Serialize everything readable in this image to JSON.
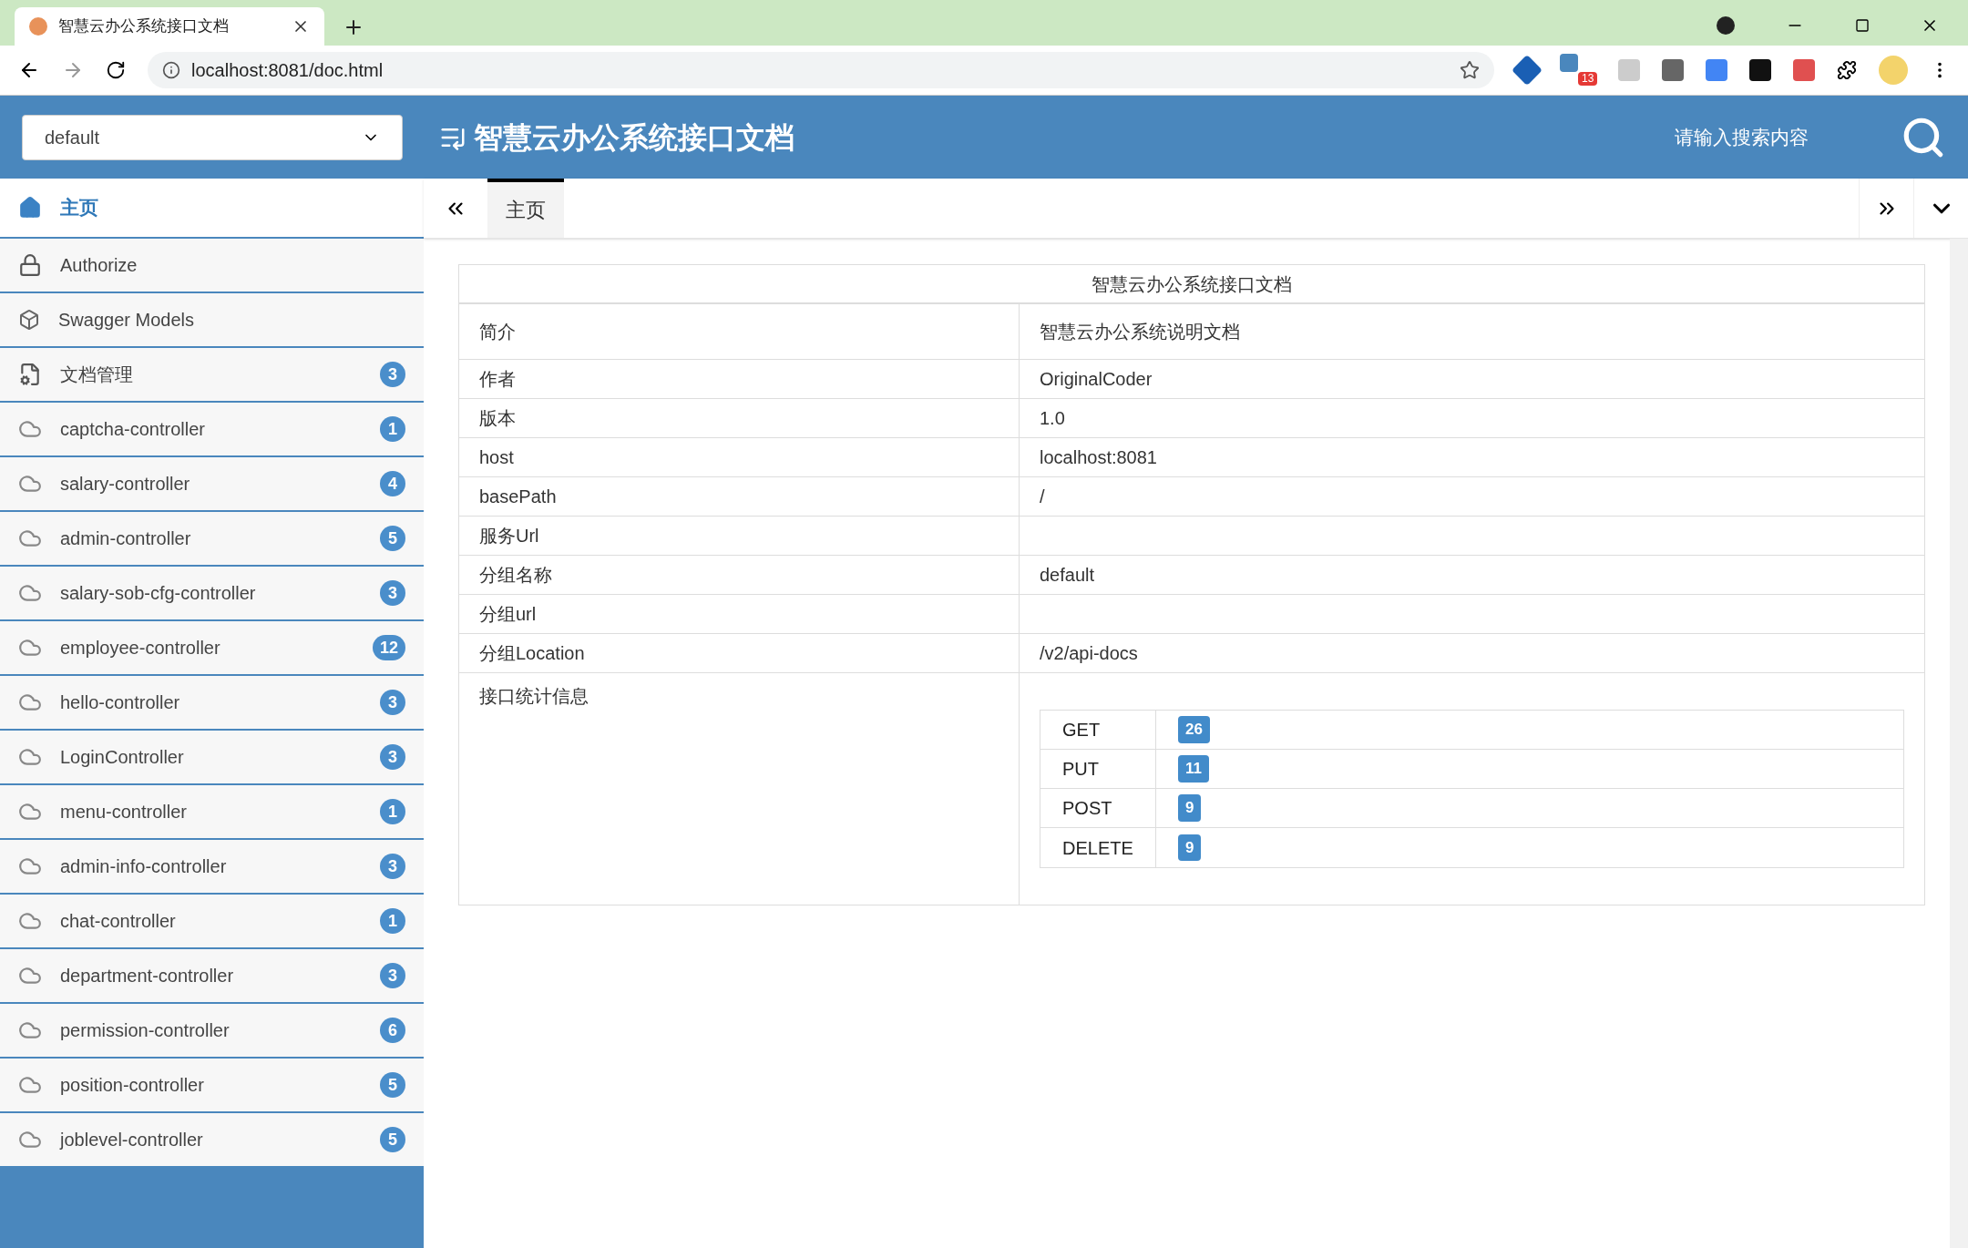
{
  "browser": {
    "tab_title": "智慧云办公系统接口文档",
    "url": "localhost:8081/doc.html",
    "extension_badge": "13"
  },
  "header": {
    "group_select": {
      "value": "default"
    },
    "title": "智慧云办公系统接口文档",
    "search": {
      "placeholder": "请输入搜索内容"
    }
  },
  "sidebar": {
    "items": [
      {
        "kind": "home",
        "label": "主页",
        "selected": true
      },
      {
        "kind": "lock",
        "label": "Authorize",
        "selected": false
      },
      {
        "kind": "models",
        "label": "Swagger Models",
        "selected": false
      },
      {
        "kind": "doc",
        "label": "文档管理",
        "badge": "3",
        "selected": false
      },
      {
        "kind": "api",
        "label": "captcha-controller",
        "badge": "1",
        "selected": false
      },
      {
        "kind": "api",
        "label": "salary-controller",
        "badge": "4",
        "selected": false
      },
      {
        "kind": "api",
        "label": "admin-controller",
        "badge": "5",
        "selected": false
      },
      {
        "kind": "api",
        "label": "salary-sob-cfg-controller",
        "badge": "3",
        "selected": false
      },
      {
        "kind": "api",
        "label": "employee-controller",
        "badge": "12",
        "selected": false
      },
      {
        "kind": "api",
        "label": "hello-controller",
        "badge": "3",
        "selected": false
      },
      {
        "kind": "api",
        "label": "LoginController",
        "badge": "3",
        "selected": false
      },
      {
        "kind": "api",
        "label": "menu-controller",
        "badge": "1",
        "selected": false
      },
      {
        "kind": "api",
        "label": "admin-info-controller",
        "badge": "3",
        "selected": false
      },
      {
        "kind": "api",
        "label": "chat-controller",
        "badge": "1",
        "selected": false
      },
      {
        "kind": "api",
        "label": "department-controller",
        "badge": "3",
        "selected": false
      },
      {
        "kind": "api",
        "label": "permission-controller",
        "badge": "6",
        "selected": false
      },
      {
        "kind": "api",
        "label": "position-controller",
        "badge": "5",
        "selected": false
      },
      {
        "kind": "api",
        "label": "joblevel-controller",
        "badge": "5",
        "selected": false
      }
    ]
  },
  "tabs": [
    {
      "label": "主页",
      "selected": true
    }
  ],
  "doc": {
    "title": "智慧云办公系统接口文档",
    "rows": [
      {
        "label": "简介",
        "value": "智慧云办公系统说明文档"
      },
      {
        "label": "作者",
        "value": "OriginalCoder"
      },
      {
        "label": "版本",
        "value": "1.0"
      },
      {
        "label": "host",
        "value": "localhost:8081"
      },
      {
        "label": "basePath",
        "value": "/"
      },
      {
        "label": "服务Url"
      },
      {
        "label": "分组名称",
        "value": "default"
      },
      {
        "label": "分组url"
      },
      {
        "label": "分组Location",
        "value": "/v2/api-docs"
      }
    ],
    "stats": {
      "label": "接口统计信息",
      "methods": [
        {
          "method": "GET",
          "count": "26"
        },
        {
          "method": "PUT",
          "count": "11"
        },
        {
          "method": "POST",
          "count": "9"
        },
        {
          "method": "DELETE",
          "count": "9"
        }
      ]
    }
  }
}
